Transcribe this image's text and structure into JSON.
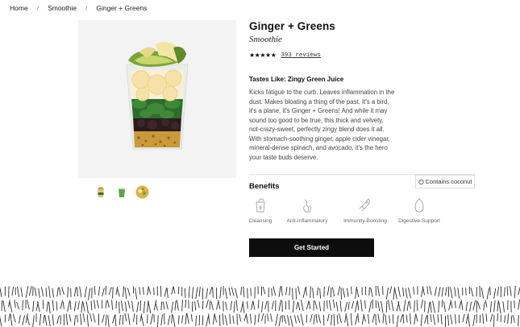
{
  "breadcrumb": {
    "items": [
      "Home",
      "Smoothie",
      "Ginger + Greens"
    ],
    "separator": "/"
  },
  "product": {
    "title": "Ginger + Greens",
    "subtitle": "Smoothie",
    "stars": "★★★★★",
    "rating_out_of_5": 4.5,
    "reviews_label": "393 reviews",
    "tastes_like": "Tastes Like: Zingy Green Juice",
    "description": "Kicks fatigue to the curb. Leaves inflammation in the dust. Makes bloating a thing of the past. It's a bird, it's a plane, it's Ginger + Greens! And while it may sound too good to be true, this thick and velvety, not-crazy-sweet, perfectly zingy blend does it all. With stomach-soothing ginger, apple cider vinegar, mineral-dense spinach, and avocado, it's the hero your taste buds deserve.",
    "allergen_badge": "Contains coconut",
    "allergen_icon": "coconut-icon"
  },
  "benefits": {
    "title": "Benefits",
    "items": [
      {
        "label": "Cleansing",
        "icon": "cleansing-icon"
      },
      {
        "label": "Anti-Inflammatory",
        "icon": "anti-inflammatory-icon"
      },
      {
        "label": "Immunity-Boosting",
        "icon": "immunity-icon"
      },
      {
        "label": "Digestive-Support",
        "icon": "digestive-icon"
      }
    ]
  },
  "cta": {
    "label": "Get Started"
  },
  "thumbnails": [
    "cup-thumbnail",
    "green-cup-thumbnail",
    "ingredients-thumbnail"
  ],
  "colors": {
    "cta_bg": "#0d0d0d",
    "hero_bg": "#f3f3f3",
    "text": "#111111"
  }
}
